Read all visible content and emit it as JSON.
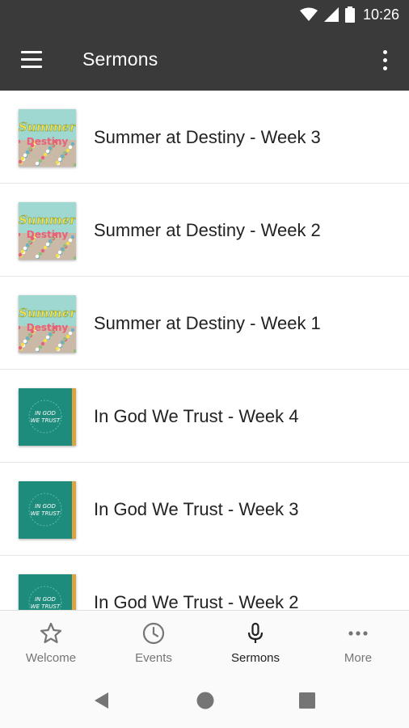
{
  "status_bar": {
    "time": "10:26"
  },
  "app_bar": {
    "title": "Sermons"
  },
  "sermons": [
    {
      "title": "Summer at Destiny - Week 3",
      "art": "summer"
    },
    {
      "title": "Summer at Destiny - Week 2",
      "art": "summer"
    },
    {
      "title": "Summer at Destiny - Week 1",
      "art": "summer"
    },
    {
      "title": "In God We Trust - Week 4",
      "art": "trust"
    },
    {
      "title": "In God We Trust - Week 3",
      "art": "trust"
    },
    {
      "title": "In God We Trust - Week 2",
      "art": "trust"
    }
  ],
  "artwork": {
    "summer": {
      "line1": "Summer",
      "line2": "Destiny"
    },
    "trust": {
      "line1": "IN GOD",
      "line2": "WE TRUST"
    }
  },
  "bottom_nav": [
    {
      "label": "Welcome",
      "icon": "star-icon",
      "active": false
    },
    {
      "label": "Events",
      "icon": "clock-icon",
      "active": false
    },
    {
      "label": "Sermons",
      "icon": "microphone-icon",
      "active": true
    },
    {
      "label": "More",
      "icon": "more-dots-icon",
      "active": false
    }
  ],
  "colors": {
    "app_bar": "#3a3a3a",
    "trust_art": "#1e8c7c",
    "summer_sky": "#9fd8d0",
    "summer_text_yellow": "#f2e14a",
    "summer_text_pink": "#e8607a",
    "gold_edge": "#d9a441"
  }
}
